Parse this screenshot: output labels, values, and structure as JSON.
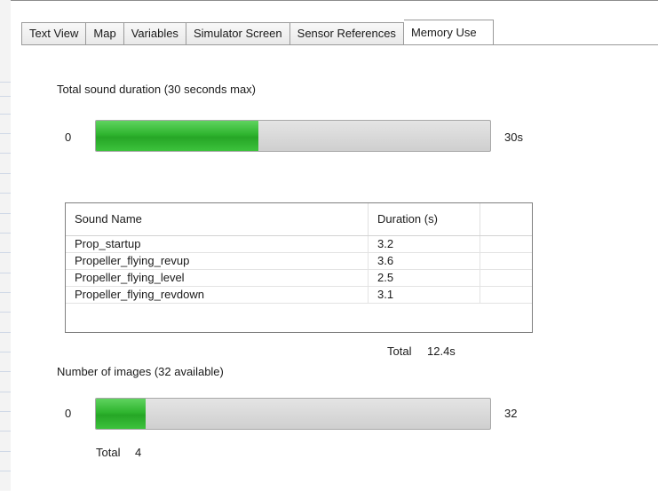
{
  "tabs": [
    {
      "label": "Text View",
      "active": false
    },
    {
      "label": "Map",
      "active": false
    },
    {
      "label": "Variables",
      "active": false
    },
    {
      "label": "Simulator Screen",
      "active": false
    },
    {
      "label": "Sensor References",
      "active": false
    },
    {
      "label": "Memory Use",
      "active": true
    }
  ],
  "sound": {
    "heading": "Total sound duration  (30 seconds max)",
    "min_label": "0",
    "max_label": "30s",
    "progress_fraction": 0.413,
    "table": {
      "columns": [
        "Sound Name",
        "Duration (s)",
        ""
      ],
      "rows": [
        {
          "name": "Prop_startup",
          "duration": "3.2"
        },
        {
          "name": "Propeller_flying_revup",
          "duration": "3.6"
        },
        {
          "name": "Propeller_flying_level",
          "duration": "2.5"
        },
        {
          "name": "Propeller_flying_revdown",
          "duration": "3.1"
        }
      ]
    },
    "total_label": "Total",
    "total_value": "12.4s"
  },
  "images": {
    "heading": "Number of images (32 available)",
    "min_label": "0",
    "max_label": "32",
    "progress_fraction": 0.125,
    "total_label": "Total",
    "total_value": "4"
  },
  "colors": {
    "progress_fill": "#2fb52f",
    "progress_track": "#d6d6d6"
  }
}
